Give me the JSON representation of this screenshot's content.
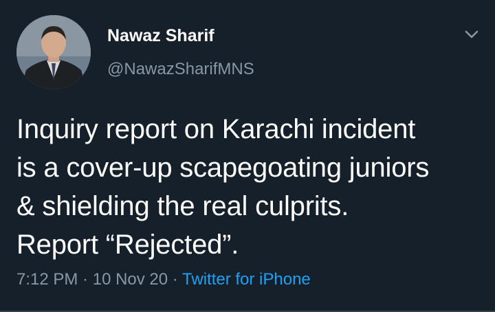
{
  "author": {
    "display_name": "Nawaz Sharif",
    "handle": "@NawazSharifMNS",
    "avatar_icon": "profile-photo"
  },
  "tweet": {
    "text_lines": [
      "Inquiry report on Karachi incident",
      "is a cover-up scapegoating juniors",
      "& shielding the real culprits.",
      "Report “Rejected”."
    ],
    "time": "7:12 PM",
    "separator1": " · ",
    "date": "10 Nov 20",
    "separator2": " · ",
    "source": "Twitter for iPhone"
  },
  "colors": {
    "background": "#15202b",
    "text_primary": "#ffffff",
    "text_secondary": "#8899a6",
    "link": "#1da1f2"
  },
  "icons": {
    "menu_caret": "chevron-down-icon"
  }
}
